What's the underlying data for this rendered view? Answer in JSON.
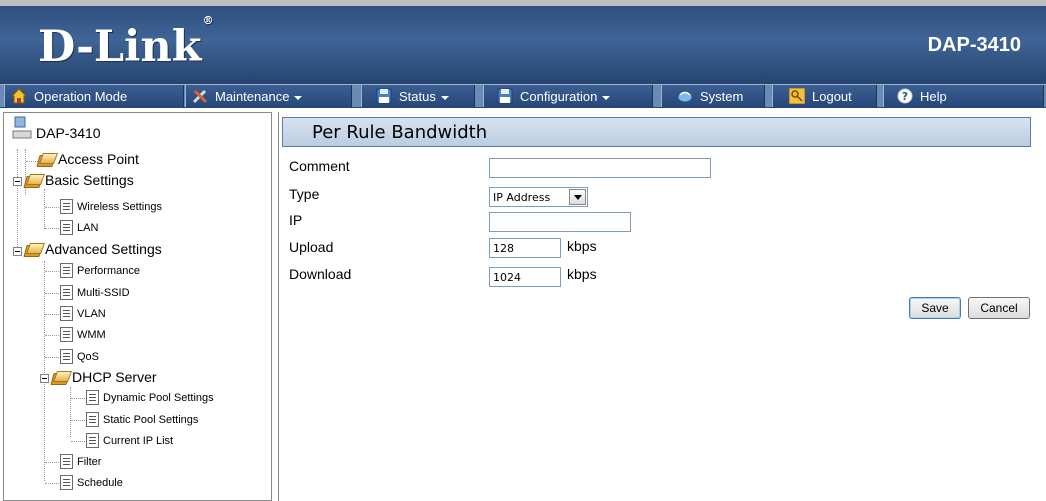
{
  "header": {
    "logo_text": "D-Link",
    "logo_mark": "®",
    "model": "DAP-3410"
  },
  "menu": [
    {
      "label": "Operation Mode",
      "icon": "house-icon",
      "dropdown": false
    },
    {
      "label": "Maintenance",
      "icon": "tools-icon",
      "dropdown": true
    },
    {
      "label": "Status",
      "icon": "floppy-icon",
      "dropdown": true
    },
    {
      "label": "Configuration",
      "icon": "floppy-icon",
      "dropdown": true
    },
    {
      "label": "System",
      "icon": "system-icon",
      "dropdown": false
    },
    {
      "label": "Logout",
      "icon": "key-icon",
      "dropdown": false
    },
    {
      "label": "Help",
      "icon": "help-icon",
      "dropdown": false
    }
  ],
  "tree": {
    "root": "DAP-3410",
    "access_point": "Access Point",
    "basic_settings": "Basic Settings",
    "wireless_settings": "Wireless Settings",
    "lan": "LAN",
    "advanced_settings": "Advanced Settings",
    "performance": "Performance",
    "multi_ssid": "Multi-SSID",
    "vlan": "VLAN",
    "wmm": "WMM",
    "qos": "QoS",
    "dhcp_server": "DHCP Server",
    "dynamic_pool": "Dynamic Pool Settings",
    "static_pool": "Static Pool Settings",
    "current_ip_list": "Current IP List",
    "filter": "Filter",
    "schedule": "Schedule"
  },
  "panel": {
    "title": "Per Rule Bandwidth",
    "comment_label": "Comment",
    "comment_value": "",
    "type_label": "Type",
    "type_value": "IP Address",
    "ip_label": "IP",
    "ip_value": "",
    "upload_label": "Upload",
    "upload_value": "128",
    "upload_unit": "kbps",
    "download_label": "Download",
    "download_value": "1024",
    "download_unit": "kbps",
    "save_label": "Save",
    "cancel_label": "Cancel"
  },
  "colors": {
    "header_blue": "#3f6496",
    "menu_blue": "#26477a",
    "title_bar": "#c8d7e8"
  }
}
